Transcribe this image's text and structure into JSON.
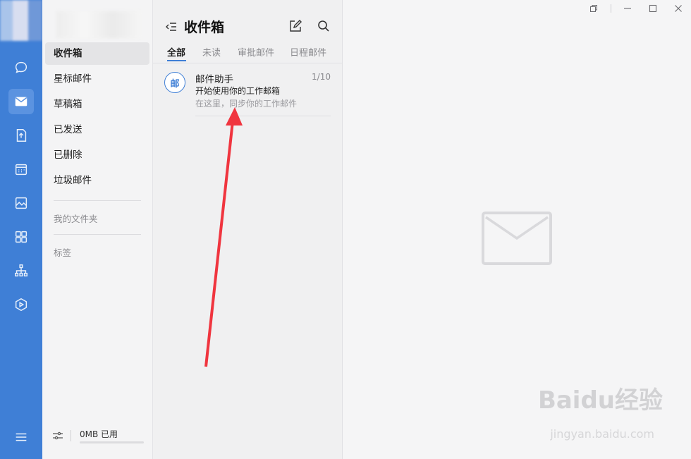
{
  "rail": {
    "items": [
      {
        "icon": "chat-bubble-icon"
      },
      {
        "icon": "mail-icon",
        "active": true
      },
      {
        "icon": "document-icon"
      },
      {
        "icon": "calendar-icon"
      },
      {
        "icon": "image-icon"
      },
      {
        "icon": "apps-grid-icon"
      },
      {
        "icon": "org-chart-icon"
      },
      {
        "icon": "cube-icon"
      }
    ],
    "menu_icon": "hamburger-menu-icon"
  },
  "folders": {
    "items": [
      {
        "label": "收件箱",
        "active": true
      },
      {
        "label": "星标邮件"
      },
      {
        "label": "草稿箱"
      },
      {
        "label": "已发送"
      },
      {
        "label": "已删除"
      },
      {
        "label": "垃圾邮件"
      }
    ],
    "my_folders": "我的文件夹",
    "tags": "标签",
    "storage": "0MB 已用"
  },
  "list": {
    "title": "收件箱",
    "tabs": [
      "全部",
      "未读",
      "审批邮件",
      "日程邮件"
    ],
    "active_tab": "全部",
    "mail": {
      "avatar_text": "邮",
      "sender": "邮件助手",
      "count": "1/10",
      "subject": "开始使用你的工作邮箱",
      "preview": "在这里，同步你的工作邮件"
    }
  },
  "watermark": {
    "brand": "Baidu经验",
    "url": "jingyan.baidu.com"
  },
  "colors": {
    "accent": "#3f7fd6",
    "arrow": "#f0353f"
  }
}
